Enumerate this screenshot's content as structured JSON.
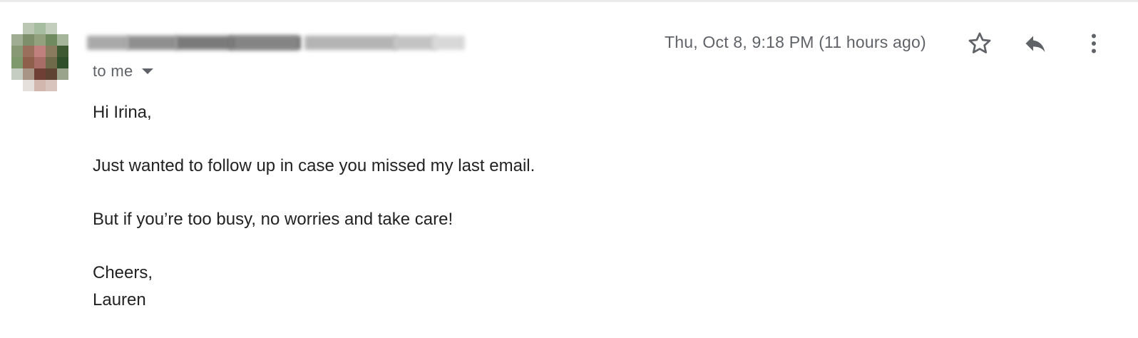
{
  "message": {
    "sender": {
      "name_redacted": true
    },
    "recipient_label": "to me",
    "timestamp": "Thu, Oct 8, 9:18 PM (11 hours ago)",
    "body": {
      "greeting": "Hi Irina,",
      "paragraph_1": "Just wanted to follow up in case you missed my last email.",
      "paragraph_2": "But if you’re too busy, no worries and take care!",
      "sign_off": "Cheers,",
      "signature": "Lauren"
    }
  },
  "actions": {
    "star_icon": "star-outline-icon",
    "reply_icon": "reply-icon",
    "more_icon": "more-vert-icon",
    "expand_icon": "chevron-down-icon"
  },
  "colors": {
    "text_primary": "#222222",
    "text_secondary": "#5f6368",
    "icon": "#5f6368",
    "divider": "#ececec"
  }
}
